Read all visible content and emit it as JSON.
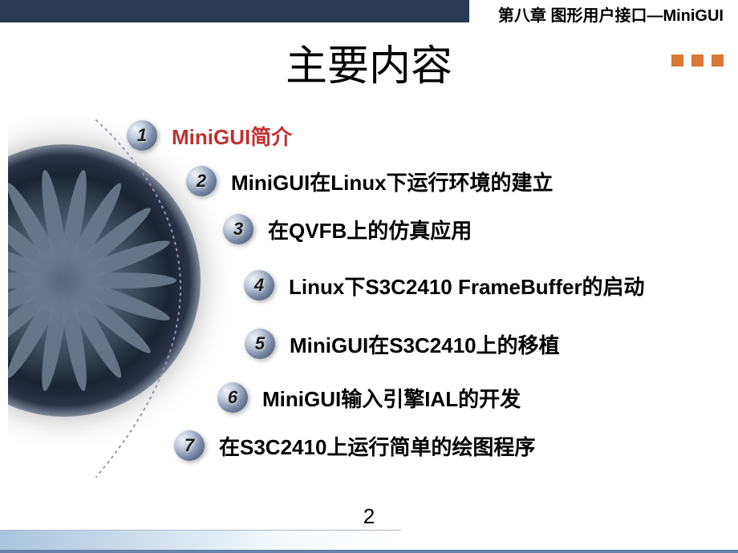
{
  "header": {
    "chapter": "第八章  图形用户接口—MiniGUI"
  },
  "title": "主要内容",
  "items": [
    {
      "num": "1",
      "label": "MiniGUI简介",
      "active": true
    },
    {
      "num": "2",
      "label": "MiniGUI在Linux下运行环境的建立",
      "active": false
    },
    {
      "num": "3",
      "label": "在QVFB上的仿真应用",
      "active": false
    },
    {
      "num": "4",
      "label": "Linux下S3C2410 FrameBuffer的启动",
      "active": false
    },
    {
      "num": "5",
      "label": "MiniGUI在S3C2410上的移植",
      "active": false
    },
    {
      "num": "6",
      "label": "MiniGUI输入引擎IAL的开发",
      "active": false
    },
    {
      "num": "7",
      "label": "在S3C2410上运行简单的绘图程序",
      "active": false
    }
  ],
  "page_number": "2"
}
